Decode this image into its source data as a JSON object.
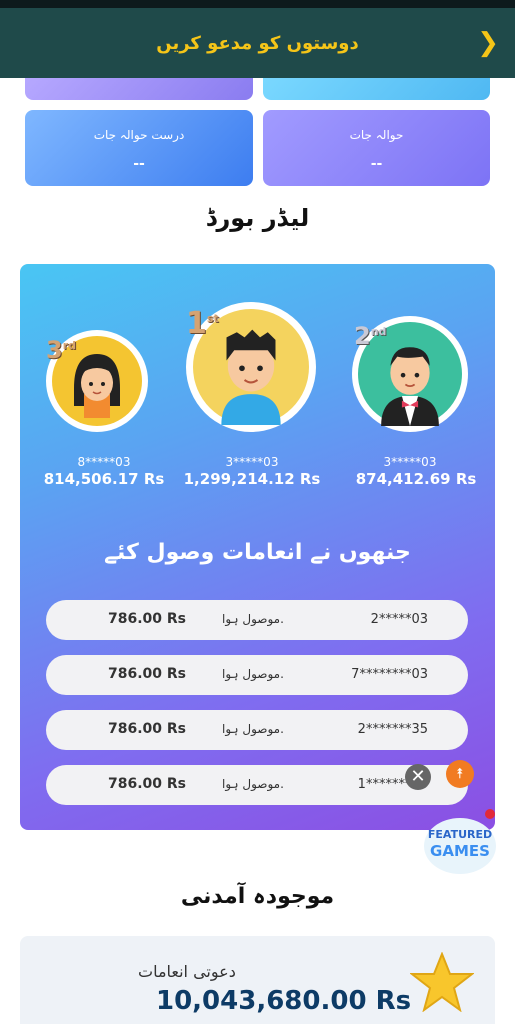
{
  "header": {
    "title": "دوستوں کو مدعو کریں"
  },
  "stats": [
    {
      "label": "درست حوالہ جات",
      "value": "--"
    },
    {
      "label": "حوالہ جات",
      "value": "--"
    }
  ],
  "leaderboard": {
    "title": "لیڈر بورڈ",
    "players": [
      {
        "rank": "3",
        "suffix": "rd",
        "id": "8*****03",
        "amount": "814,506.17 Rs"
      },
      {
        "rank": "1",
        "suffix": "st",
        "id": "3*****03",
        "amount": "1,299,214.12 Rs"
      },
      {
        "rank": "2",
        "suffix": "nd",
        "id": "3*****03",
        "amount": "874,412.69 Rs"
      }
    ],
    "rewards_title": "جنھوں نے انعامات وصول کئے",
    "rewards": [
      {
        "amount": "786.00 Rs",
        "status": "موصول ہوا.",
        "user": "2*****03"
      },
      {
        "amount": "786.00 Rs",
        "status": "موصول ہوا.",
        "user": "7********03"
      },
      {
        "amount": "786.00 Rs",
        "status": "موصول ہوا.",
        "user": "2*******35"
      },
      {
        "amount": "786.00 Rs",
        "status": "موصول ہوا.",
        "user": "1*******03"
      }
    ]
  },
  "featured_games": {
    "label": "FEATURED GAMES"
  },
  "earnings": {
    "title": "موجودہ آمدنی",
    "invite_label": "دعوتی انعامات",
    "invite_value": "10,043,680.00 Rs"
  },
  "colors": {
    "header_bg": "#1f4a4a",
    "header_text": "#f5c518",
    "accent": "#f17b22"
  }
}
